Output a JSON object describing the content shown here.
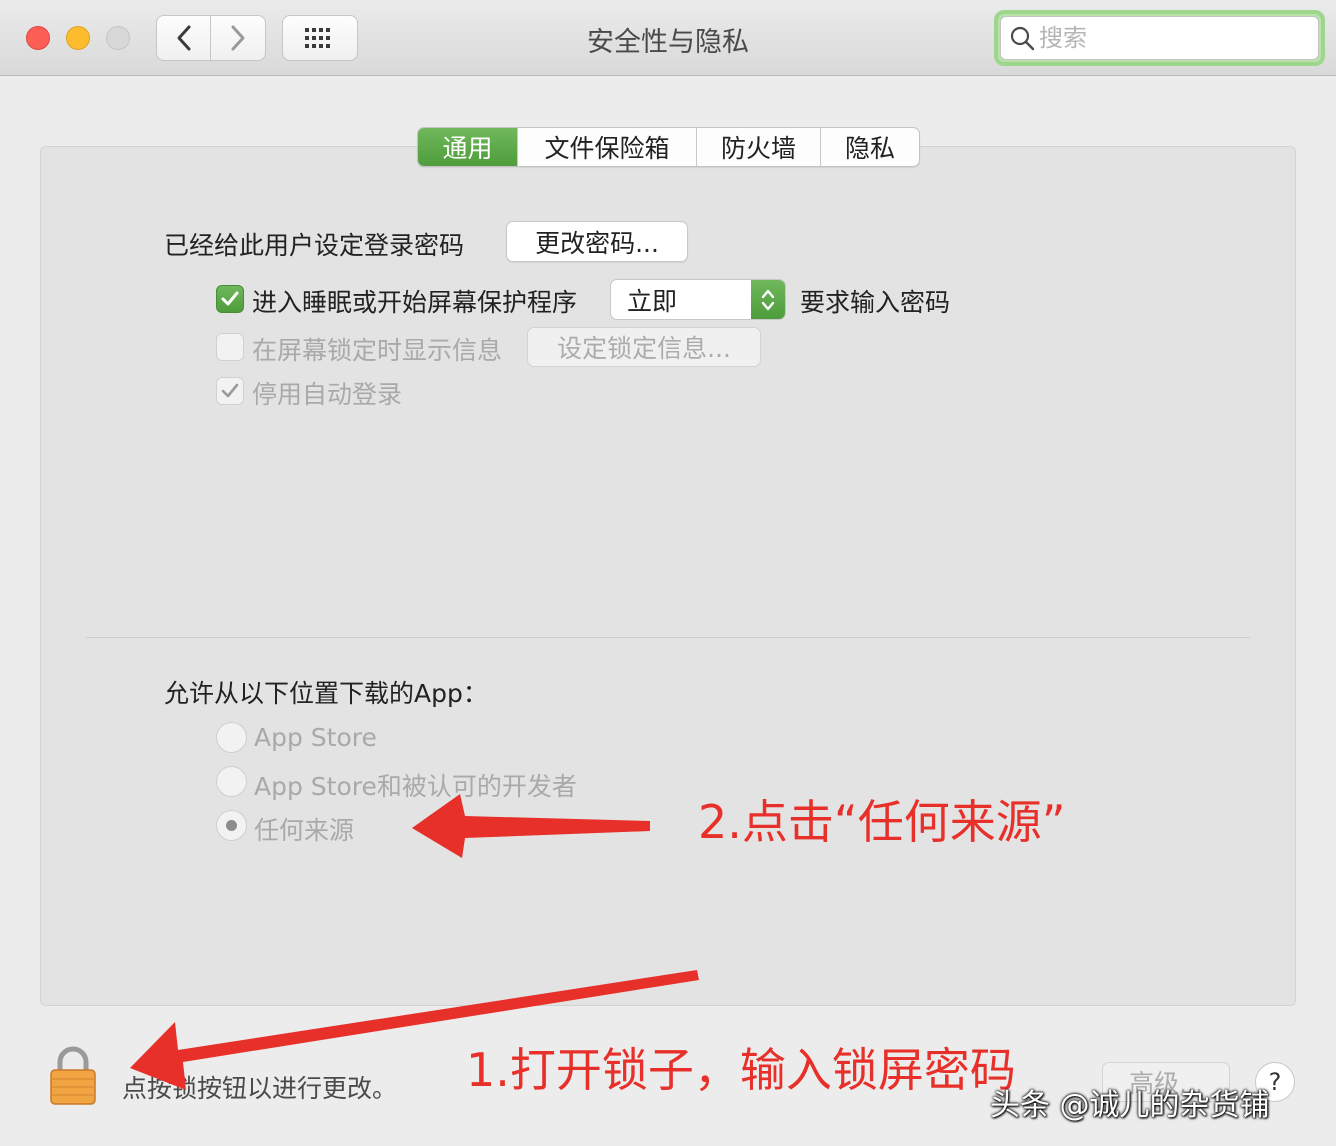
{
  "window": {
    "title": "安全性与隐私",
    "search_placeholder": "搜索"
  },
  "tabs": [
    {
      "label": "通用",
      "active": true
    },
    {
      "label": "文件保险箱",
      "active": false
    },
    {
      "label": "防火墙",
      "active": false
    },
    {
      "label": "隐私",
      "active": false
    }
  ],
  "general": {
    "password_label": "已经给此用户设定登录密码",
    "change_password_button": "更改密码...",
    "sleep_checkbox": {
      "label": "进入睡眠或开始屏幕保护程序",
      "checked": true
    },
    "require_popup_value": "立即",
    "require_suffix": "要求输入密码",
    "lock_message_checkbox": {
      "label": "在屏幕锁定时显示信息",
      "checked": false
    },
    "set_lock_message_button": "设定锁定信息...",
    "disable_autologin_checkbox": {
      "label": "停用自动登录",
      "checked": true
    }
  },
  "downloads": {
    "heading": "允许从以下位置下载的App：",
    "options": [
      {
        "label": "App Store",
        "selected": false
      },
      {
        "label": "App Store和被认可的开发者",
        "selected": false
      },
      {
        "label": "任何来源",
        "selected": true
      }
    ]
  },
  "footer": {
    "lock_text": "点按锁按钮以进行更改。",
    "advanced_button": "高级...",
    "help_button": "?"
  },
  "annotations": {
    "step1": "1.打开锁子，输入锁屏密码",
    "step2": "2.点击“任何来源”",
    "watermark": "头条 @诚儿的杂货铺",
    "color": "#e8302a"
  },
  "colors": {
    "accent_green": "#5aa846",
    "close": "#fd5f57",
    "minimize": "#fdbb2e"
  }
}
